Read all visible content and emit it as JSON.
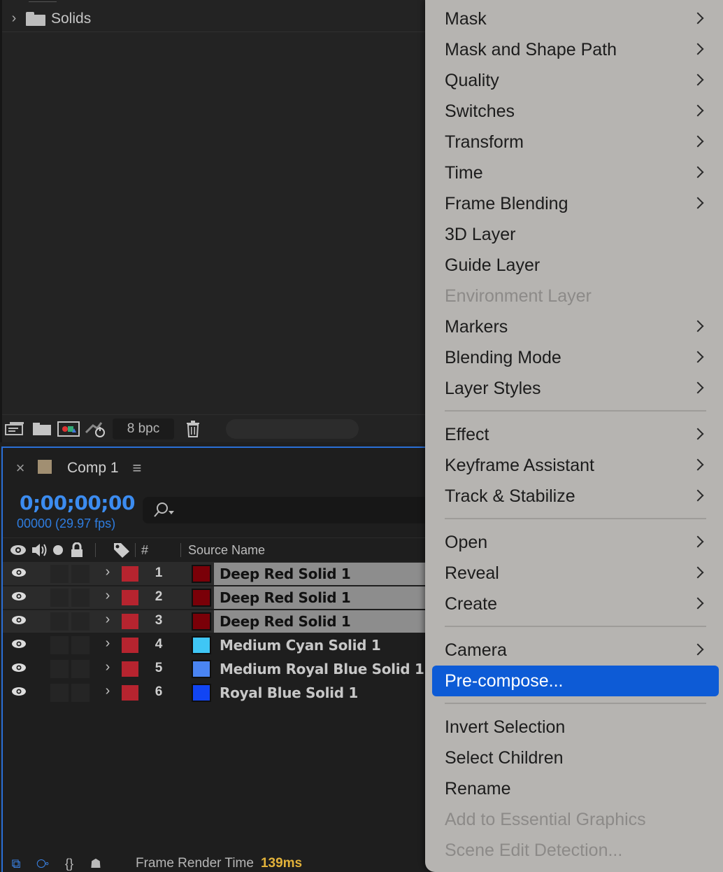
{
  "project": {
    "folder_name": "Solids",
    "bpc_label": "8 bpc"
  },
  "timeline": {
    "comp_title": "Comp 1",
    "timecode": "0;00;00;00",
    "fps_label": "00000 (29.97 fps)",
    "col_number": "#",
    "col_source_name": "Source Name",
    "layers": [
      {
        "num": "1",
        "name": "Deep Red Solid 1",
        "color": "#7a0008",
        "selected": true
      },
      {
        "num": "2",
        "name": "Deep Red Solid 1",
        "color": "#7a0008",
        "selected": true
      },
      {
        "num": "3",
        "name": "Deep Red Solid 1",
        "color": "#7a0008",
        "selected": true
      },
      {
        "num": "4",
        "name": "Medium Cyan Solid 1",
        "color": "#3fc6f5",
        "selected": false
      },
      {
        "num": "5",
        "name": "Medium Royal Blue Solid 1",
        "color": "#4a84f2",
        "selected": false
      },
      {
        "num": "6",
        "name": "Royal Blue Solid 1",
        "color": "#1145f4",
        "selected": false
      }
    ],
    "frame_render_label": "Frame Render Time",
    "frame_render_value": "139ms"
  },
  "menu": {
    "items": [
      {
        "label": "Mask",
        "submenu": true,
        "disabled": false
      },
      {
        "label": "Mask and Shape Path",
        "submenu": true,
        "disabled": false
      },
      {
        "label": "Quality",
        "submenu": true,
        "disabled": false
      },
      {
        "label": "Switches",
        "submenu": true,
        "disabled": false
      },
      {
        "label": "Transform",
        "submenu": true,
        "disabled": false
      },
      {
        "label": "Time",
        "submenu": true,
        "disabled": false
      },
      {
        "label": "Frame Blending",
        "submenu": true,
        "disabled": false
      },
      {
        "label": "3D Layer",
        "submenu": false,
        "disabled": false
      },
      {
        "label": "Guide Layer",
        "submenu": false,
        "disabled": false
      },
      {
        "label": "Environment Layer",
        "submenu": false,
        "disabled": true
      },
      {
        "label": "Markers",
        "submenu": true,
        "disabled": false
      },
      {
        "label": "Blending Mode",
        "submenu": true,
        "disabled": false
      },
      {
        "label": "Layer Styles",
        "submenu": true,
        "disabled": false
      },
      {
        "label": "Effect",
        "submenu": true,
        "disabled": false
      },
      {
        "label": "Keyframe Assistant",
        "submenu": true,
        "disabled": false
      },
      {
        "label": "Track & Stabilize",
        "submenu": true,
        "disabled": false
      },
      {
        "label": "Open",
        "submenu": true,
        "disabled": false
      },
      {
        "label": "Reveal",
        "submenu": true,
        "disabled": false
      },
      {
        "label": "Create",
        "submenu": true,
        "disabled": false
      },
      {
        "label": "Camera",
        "submenu": true,
        "disabled": false
      },
      {
        "label": "Pre-compose...",
        "submenu": false,
        "disabled": false,
        "highlighted": true
      },
      {
        "label": "Invert Selection",
        "submenu": false,
        "disabled": false
      },
      {
        "label": "Select Children",
        "submenu": false,
        "disabled": false
      },
      {
        "label": "Rename",
        "submenu": false,
        "disabled": false
      },
      {
        "label": "Add to Essential Graphics",
        "submenu": false,
        "disabled": true
      },
      {
        "label": "Scene Edit Detection...",
        "submenu": false,
        "disabled": true
      }
    ]
  }
}
